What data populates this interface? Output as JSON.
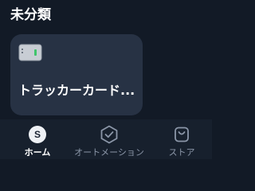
{
  "section": {
    "title": "未分類"
  },
  "devices": [
    {
      "name": "トラッカーカード...",
      "icon": "tracker-card-icon"
    }
  ],
  "tab_bar": {
    "tabs": [
      {
        "label": "ホーム",
        "icon": "home-avatar-icon",
        "icon_letter": "S",
        "active": true
      },
      {
        "label": "オートメーション",
        "icon": "check-badge-icon",
        "active": false
      },
      {
        "label": "ストア",
        "icon": "shopping-bag-icon",
        "active": false
      }
    ]
  },
  "colors": {
    "background": "#121a26",
    "card": "#273244",
    "tab_bar": "#17202d",
    "active_tab": "#ffffff",
    "inactive_tab": "#8b96a8",
    "tracker_led": "#3fc56b"
  }
}
